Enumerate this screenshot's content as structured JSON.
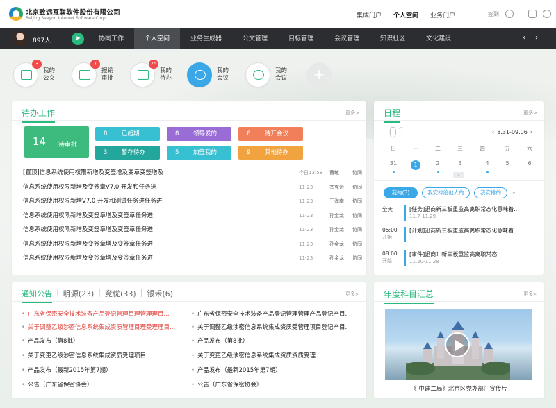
{
  "header": {
    "company_cn": "北京致远互联软件股份有限公司",
    "company_en": "Beijing Seeyon Internet Software Corp.",
    "portals": [
      "集成门户",
      "个人空间",
      "业务门户"
    ],
    "active_portal": 1,
    "signin": "签到"
  },
  "navbar": {
    "people_count": "897人",
    "items": [
      "协同工作",
      "个人空间",
      "业务生成器",
      "公文管理",
      "目标管理",
      "会议管理",
      "知识社区",
      "文化建设"
    ],
    "active": 1,
    "prev": "‹",
    "next": "›"
  },
  "quick": [
    {
      "label": "我的公文",
      "badge": "3"
    },
    {
      "label": "报销审批",
      "badge": "7"
    },
    {
      "label": "我的待办",
      "badge": "25"
    },
    {
      "label": "我的会议",
      "badge": ""
    },
    {
      "label": "我的会议",
      "badge": ""
    }
  ],
  "todo": {
    "title": "待办工作",
    "more": "更多>",
    "big": {
      "count": "14",
      "label": "待审批",
      "color": "#3dbb7e"
    },
    "tiles": [
      {
        "count": "8",
        "label": "已超期",
        "color": "#37c0d2"
      },
      {
        "count": "3",
        "label": "暂存待办",
        "color": "#23a79c"
      },
      {
        "count": "8",
        "label": "领导发的",
        "color": "#9a6cd6"
      },
      {
        "count": "5",
        "label": "加签我的",
        "color": "#37c0d2"
      },
      {
        "count": "6",
        "label": "待开会议",
        "color": "#f07f5a"
      },
      {
        "count": "9",
        "label": "其他待办",
        "color": "#f1a33f"
      }
    ],
    "rows": [
      {
        "subject": "[置顶]信息系统使用权限新增及变签增及变章变签增及",
        "date": "今日13:58",
        "person": "曹敏",
        "category": "协同"
      },
      {
        "subject": "信息系统使用权限新增及变签章V7.0 开发和任务进",
        "date": "11-23",
        "person": "杰克逊",
        "category": "协同"
      },
      {
        "subject": "信息系统使用权限新增V7.0 开发和测试任务进任务进",
        "date": "11-23",
        "person": "王海南",
        "category": "协同"
      },
      {
        "subject": "信息系统使用权限新增及变签章增及变签章任务进",
        "date": "11-23",
        "person": "孙金龙",
        "category": "协同"
      },
      {
        "subject": "信息系统使用权限新增及变签章增及变签章任务进",
        "date": "11-23",
        "person": "孙金龙",
        "category": "协同"
      },
      {
        "subject": "信息系统使用权限新增及变签章增及变签章任务进",
        "date": "11-23",
        "person": "孙金龙",
        "category": "协同"
      },
      {
        "subject": "信息系统使用权限新增及变签章增及变签章任务进",
        "date": "11-23",
        "person": "孙金龙",
        "category": "协同"
      }
    ]
  },
  "calendar": {
    "title": "日程",
    "more": "更多>",
    "month": "01",
    "range": "8.31-09.06",
    "weekdays": [
      "日",
      "一",
      "二",
      "三",
      "四",
      "五",
      "六"
    ],
    "dates": [
      "31",
      "1",
      "2",
      "3",
      "4",
      "5",
      "6"
    ],
    "selected": 1,
    "filters": [
      "我的(3)",
      "我安排给他人的",
      "我安排的"
    ],
    "events": [
      {
        "time": "全天",
        "time2": "",
        "title": "[任务]迅商新三板重监高离职常态化意味着...",
        "sub": "11.7-11.29"
      },
      {
        "time": "05:00",
        "time2": "开始",
        "title": "[计划]迅商新三板重监高离职常态化意味着",
        "sub": ""
      },
      {
        "time": "08:00",
        "time2": "开始",
        "title": "[事件]迅商！新三板重监高离职常态",
        "sub": "11.20-11.28"
      }
    ]
  },
  "notice": {
    "tabs": [
      "通知公告",
      "明源(23)",
      "竞优(33)",
      "银禾(6)"
    ],
    "more": "更多>",
    "left": [
      {
        "text": "广东省保密安全技术装备产品登记管理目理管理理目...",
        "red": true
      },
      {
        "text": "关于调整乙级涉密信息系统集成资质管理目理受理理目...",
        "red": true
      },
      {
        "text": "产品发布（第8批）",
        "red": false
      },
      {
        "text": "关于变更乙级涉密信息系统集成资质受理项目",
        "red": false
      },
      {
        "text": "产品发布（最新2015年第7期）",
        "red": false
      },
      {
        "text": "公告（广东省保密协会）",
        "red": false
      }
    ],
    "right": [
      {
        "text": "广东省保密安全技术装备产品登记管理管理产品登记产目...",
        "red": false
      },
      {
        "text": "关于调整乙级涉密信息系统集成资质受管理项目登记产目...",
        "red": false
      },
      {
        "text": "产品发布（第8批）",
        "red": false
      },
      {
        "text": "关于变更乙级涉密信息系统集成资质资质受理",
        "red": false
      },
      {
        "text": "产品发布（最新2015年第7期）",
        "red": false
      },
      {
        "text": "公告（广东省保密协会）",
        "red": false
      }
    ]
  },
  "annual": {
    "title": "年度科目汇总",
    "more": "更多>",
    "caption": "《 中建二局》北京区党办部门宣传片"
  }
}
